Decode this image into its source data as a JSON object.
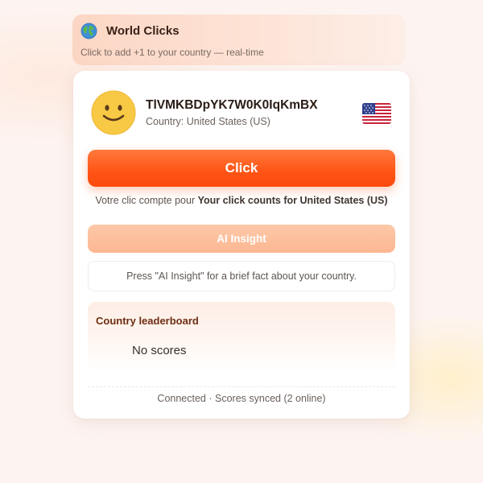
{
  "header": {
    "title": "World Clicks",
    "subtitle": "Click to add +1 to your country — real-time",
    "icon": "globe-icon"
  },
  "user": {
    "avatar_icon": "smiley-face-icon",
    "username": "TlVMKBDpYK7W0K0IqKmBX",
    "country_label": "Country: United States (US)",
    "flag_icon": "us-flag-icon"
  },
  "actions": {
    "click_label": "Click",
    "click_note_prefix": "Votre clic compte pour",
    "click_note_bold": "Your click counts for United States (US)",
    "ai_insight_label": "AI Insight"
  },
  "fact": {
    "text": "Press \"AI Insight\" for a brief fact about your country."
  },
  "leaderboard": {
    "title": "Country leaderboard",
    "empty_text": "No scores"
  },
  "status": {
    "text": "Connected · Scores synced (2 online)"
  },
  "colors": {
    "accent": "#ff5416",
    "accent_light": "#fcb792",
    "header_bg": "#fcd6c4",
    "page_bg": "#fdf4f1",
    "leaderboard_title": "#6e2d12"
  }
}
